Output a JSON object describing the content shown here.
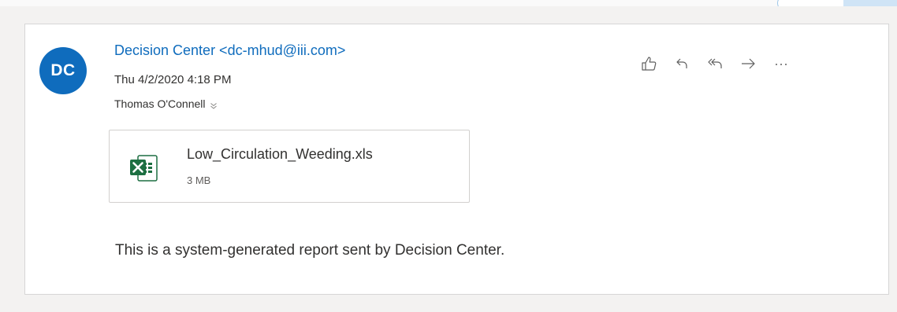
{
  "email": {
    "avatar_initials": "DC",
    "avatar_color": "#0f6cbd",
    "sender": "Decision Center <dc-mhud@iii.com>",
    "date": "Thu 4/2/2020 4:18 PM",
    "recipient": "Thomas O'Connell",
    "body": "This is a system-generated report sent by Decision Center."
  },
  "actions": [
    {
      "name": "like",
      "icon": "thumbs-up-icon"
    },
    {
      "name": "reply",
      "icon": "reply-icon"
    },
    {
      "name": "reply-all",
      "icon": "reply-all-icon"
    },
    {
      "name": "forward",
      "icon": "forward-arrow-icon"
    },
    {
      "name": "more",
      "icon": "more-icon"
    }
  ],
  "attachment": {
    "file_name": "Low_Circulation_Weeding.xls",
    "file_size": "3 MB",
    "icon": "excel-file-icon",
    "icon_color": "#1d6f42"
  },
  "colors": {
    "accent": "#0f6cbd",
    "background": "#f3f2f1",
    "card": "#ffffff"
  }
}
